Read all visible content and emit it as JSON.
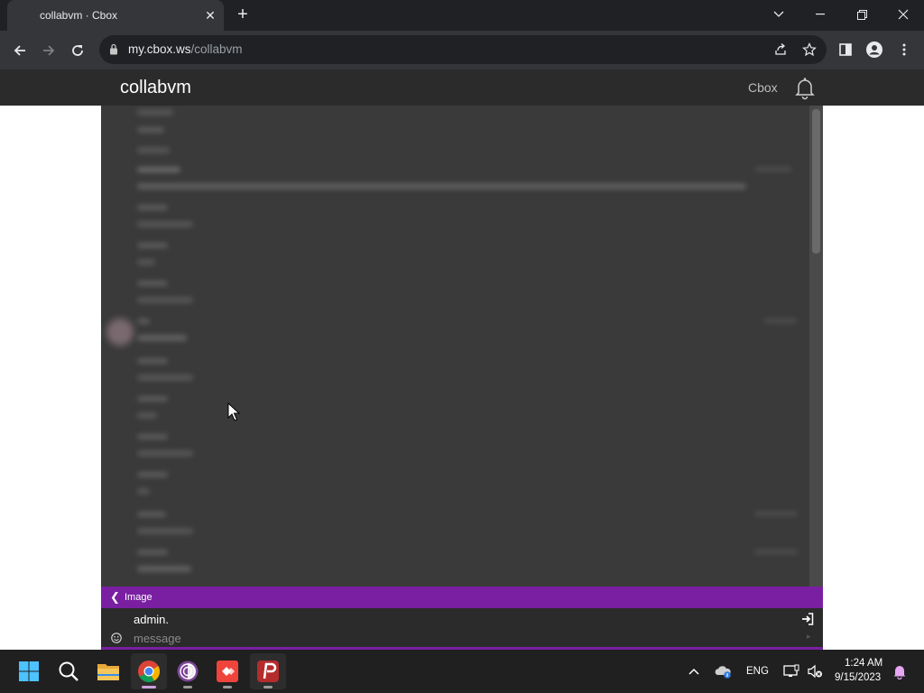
{
  "browser": {
    "tab_title": "collabvm · Cbox",
    "url_domain": "my.cbox.ws",
    "url_path": "/collabvm"
  },
  "cbox": {
    "room_title": "collabvm",
    "cbox_link": "Cbox",
    "bottom_bar_label": "Image",
    "username": "admin.",
    "message_placeholder": "message",
    "accent_color": "#7a1fa2"
  },
  "taskbar": {
    "apps": [
      "start-icon",
      "search-icon",
      "file-explorer-icon",
      "chrome-icon",
      "tor-browser-icon",
      "anydesk-icon",
      "psiphon-icon"
    ],
    "language": "ENG",
    "time": "1:24 AM",
    "date": "9/15/2023"
  }
}
